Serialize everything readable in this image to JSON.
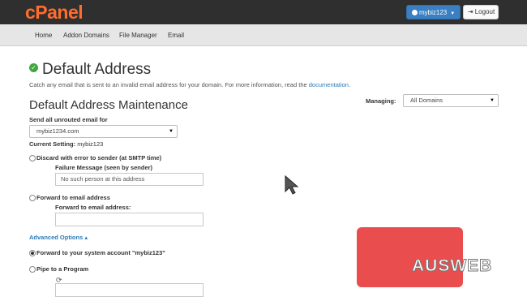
{
  "header": {
    "logo": "cPanel",
    "user_label": "mybiz123",
    "logout_label": "Logout"
  },
  "nav": {
    "items": [
      "Home",
      "Addon Domains",
      "File Manager",
      "Email"
    ]
  },
  "page": {
    "title": "Default Address",
    "description": "Catch any email that is sent to an invalid email address for your domain. For more information, read the",
    "description_link": "documentation",
    "description_end": "."
  },
  "managing": {
    "label": "Managing:",
    "value": "All Domains"
  },
  "section": {
    "title": "Default Address Maintenance",
    "send_label": "Send all unrouted email for",
    "domain_value": "mybiz1234.com",
    "current_setting_label": "Current Setting:",
    "current_setting_value": "mybiz123"
  },
  "options": {
    "discard_label": "Discard with error to sender (at SMTP time)",
    "failure_label": "Failure Message (seen by sender)",
    "failure_placeholder": "No such person at this address",
    "forward_label": "Forward to email address",
    "forward_field_label": "Forward to email address:",
    "advanced_label": "Advanced Options",
    "system_account_label": "Forward to your system account \"mybiz123\"",
    "pipe_label": "Pipe to a Program"
  },
  "watermark": {
    "text": "AUSWEB"
  },
  "colors": {
    "topbar": "#2f2f2f",
    "logo": "#ff6c2c",
    "user_button": "#3a7fc2",
    "link": "#2a7ab8",
    "watermark": "#e84040"
  }
}
